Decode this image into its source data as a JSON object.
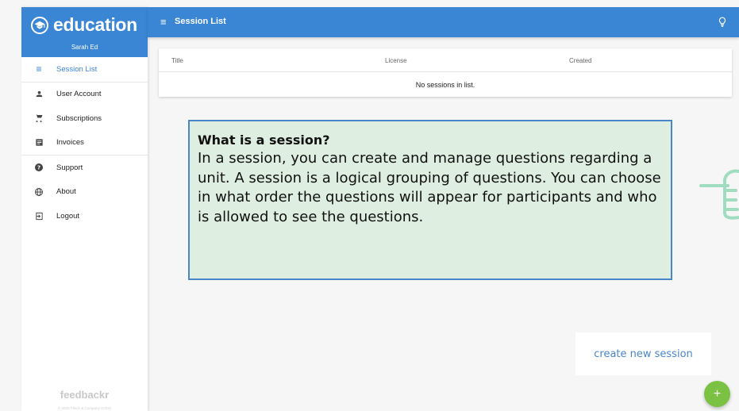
{
  "brand": {
    "name": "education",
    "user": "Sarah Ed"
  },
  "nav": [
    {
      "label": "Session List",
      "icon": "list-icon",
      "active": true
    },
    {
      "label": "User Account",
      "icon": "person-icon"
    },
    {
      "label": "Subscriptions",
      "icon": "cart-icon"
    },
    {
      "label": "Invoices",
      "icon": "invoice-icon"
    },
    {
      "label": "Support",
      "icon": "help-icon"
    },
    {
      "label": "About",
      "icon": "globe-icon"
    },
    {
      "label": "Logout",
      "icon": "logout-icon"
    }
  ],
  "footer": {
    "logo": "feedbackr",
    "copyright": "© 2020 Fäsch & Company GmbH"
  },
  "topbar": {
    "title": "Session List"
  },
  "table": {
    "columns": [
      "Title",
      "License",
      "Created"
    ],
    "empty_message": "No sessions in list."
  },
  "help": {
    "title": "What is a session?",
    "text": "In a session, you can create and manage questions regarding a unit. A session is a logical grouping of questions. You can choose in what order the questions will appear for participants and who is allowed to see the questions."
  },
  "actions": {
    "create_label": "create new session",
    "fab_label": "+"
  },
  "colors": {
    "primary": "#3a86d4",
    "fab": "#7bc143",
    "help_bg": "#deeee0",
    "help_border": "#4a85c8"
  }
}
